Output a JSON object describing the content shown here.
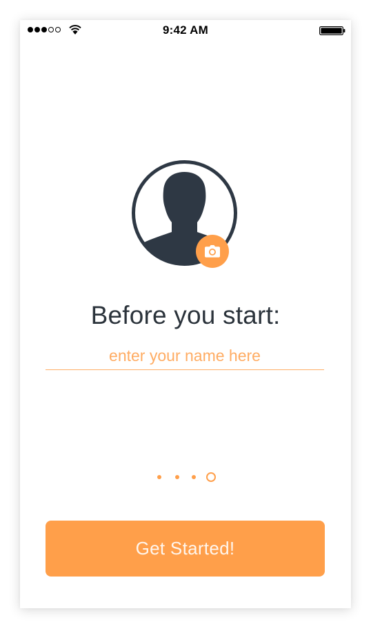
{
  "status_bar": {
    "time": "9:42 AM",
    "signal_filled": 3,
    "signal_total": 5
  },
  "profile": {
    "avatar_icon": "person-silhouette-icon",
    "camera_icon": "camera-icon"
  },
  "onboarding": {
    "heading": "Before you start:",
    "name_placeholder": "enter your name here",
    "name_value": ""
  },
  "pagination": {
    "total": 4,
    "current": 4
  },
  "cta": {
    "label": "Get Started!"
  },
  "colors": {
    "accent": "#ff9f4a",
    "text_dark": "#2b333b",
    "avatar_dark": "#2e3844",
    "background": "#ffffff"
  }
}
